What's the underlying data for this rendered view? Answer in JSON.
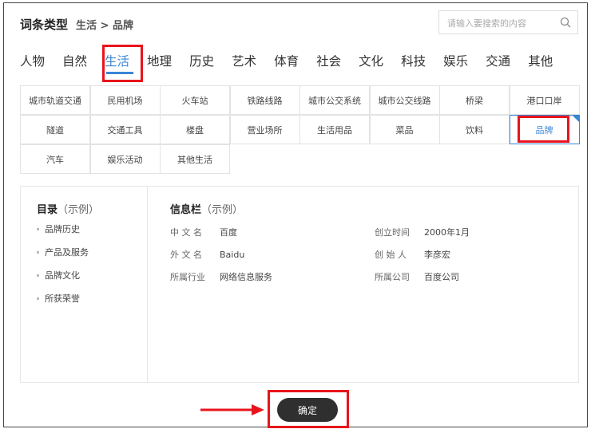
{
  "header": {
    "title": "词条类型",
    "breadcrumb": "生活 > 品牌",
    "search_placeholder": "请输入要搜索的内容"
  },
  "tabs": [
    "人物",
    "自然",
    "生活",
    "地理",
    "历史",
    "艺术",
    "体育",
    "社会",
    "文化",
    "科技",
    "娱乐",
    "交通",
    "其他"
  ],
  "active_tab": "生活",
  "subcategories": [
    [
      "城市轨道交通",
      "民用机场",
      "火车站",
      "铁路线路",
      "城市公交系统",
      "城市公交线路",
      "桥梁",
      "港口口岸"
    ],
    [
      "隧道",
      "交通工具",
      "楼盘",
      "营业场所",
      "生活用品",
      "菜品",
      "饮料",
      "品牌"
    ],
    [
      "汽车",
      "娱乐活动",
      "其他生活"
    ]
  ],
  "selected_subcategory": "品牌",
  "preview": {
    "toc": {
      "title": "目录",
      "hint": "（示例）",
      "items": [
        "品牌历史",
        "产品及服务",
        "品牌文化",
        "所获荣誉"
      ]
    },
    "info": {
      "title": "信息栏",
      "hint": "（示例）",
      "left": [
        {
          "key": "中 文 名",
          "value": "百度"
        },
        {
          "key": "外 文 名",
          "value": "Baidu"
        },
        {
          "key": "所属行业",
          "value": "网络信息服务"
        }
      ],
      "right": [
        {
          "key": "创立时间",
          "value": "2000年1月"
        },
        {
          "key": "创 始 人",
          "value": "李彦宏"
        },
        {
          "key": "所属公司",
          "value": "百度公司"
        }
      ]
    }
  },
  "confirm_label": "确定",
  "colors": {
    "accent": "#3a86d6",
    "annotation": "#e8141b",
    "button": "#2f2f2f"
  }
}
